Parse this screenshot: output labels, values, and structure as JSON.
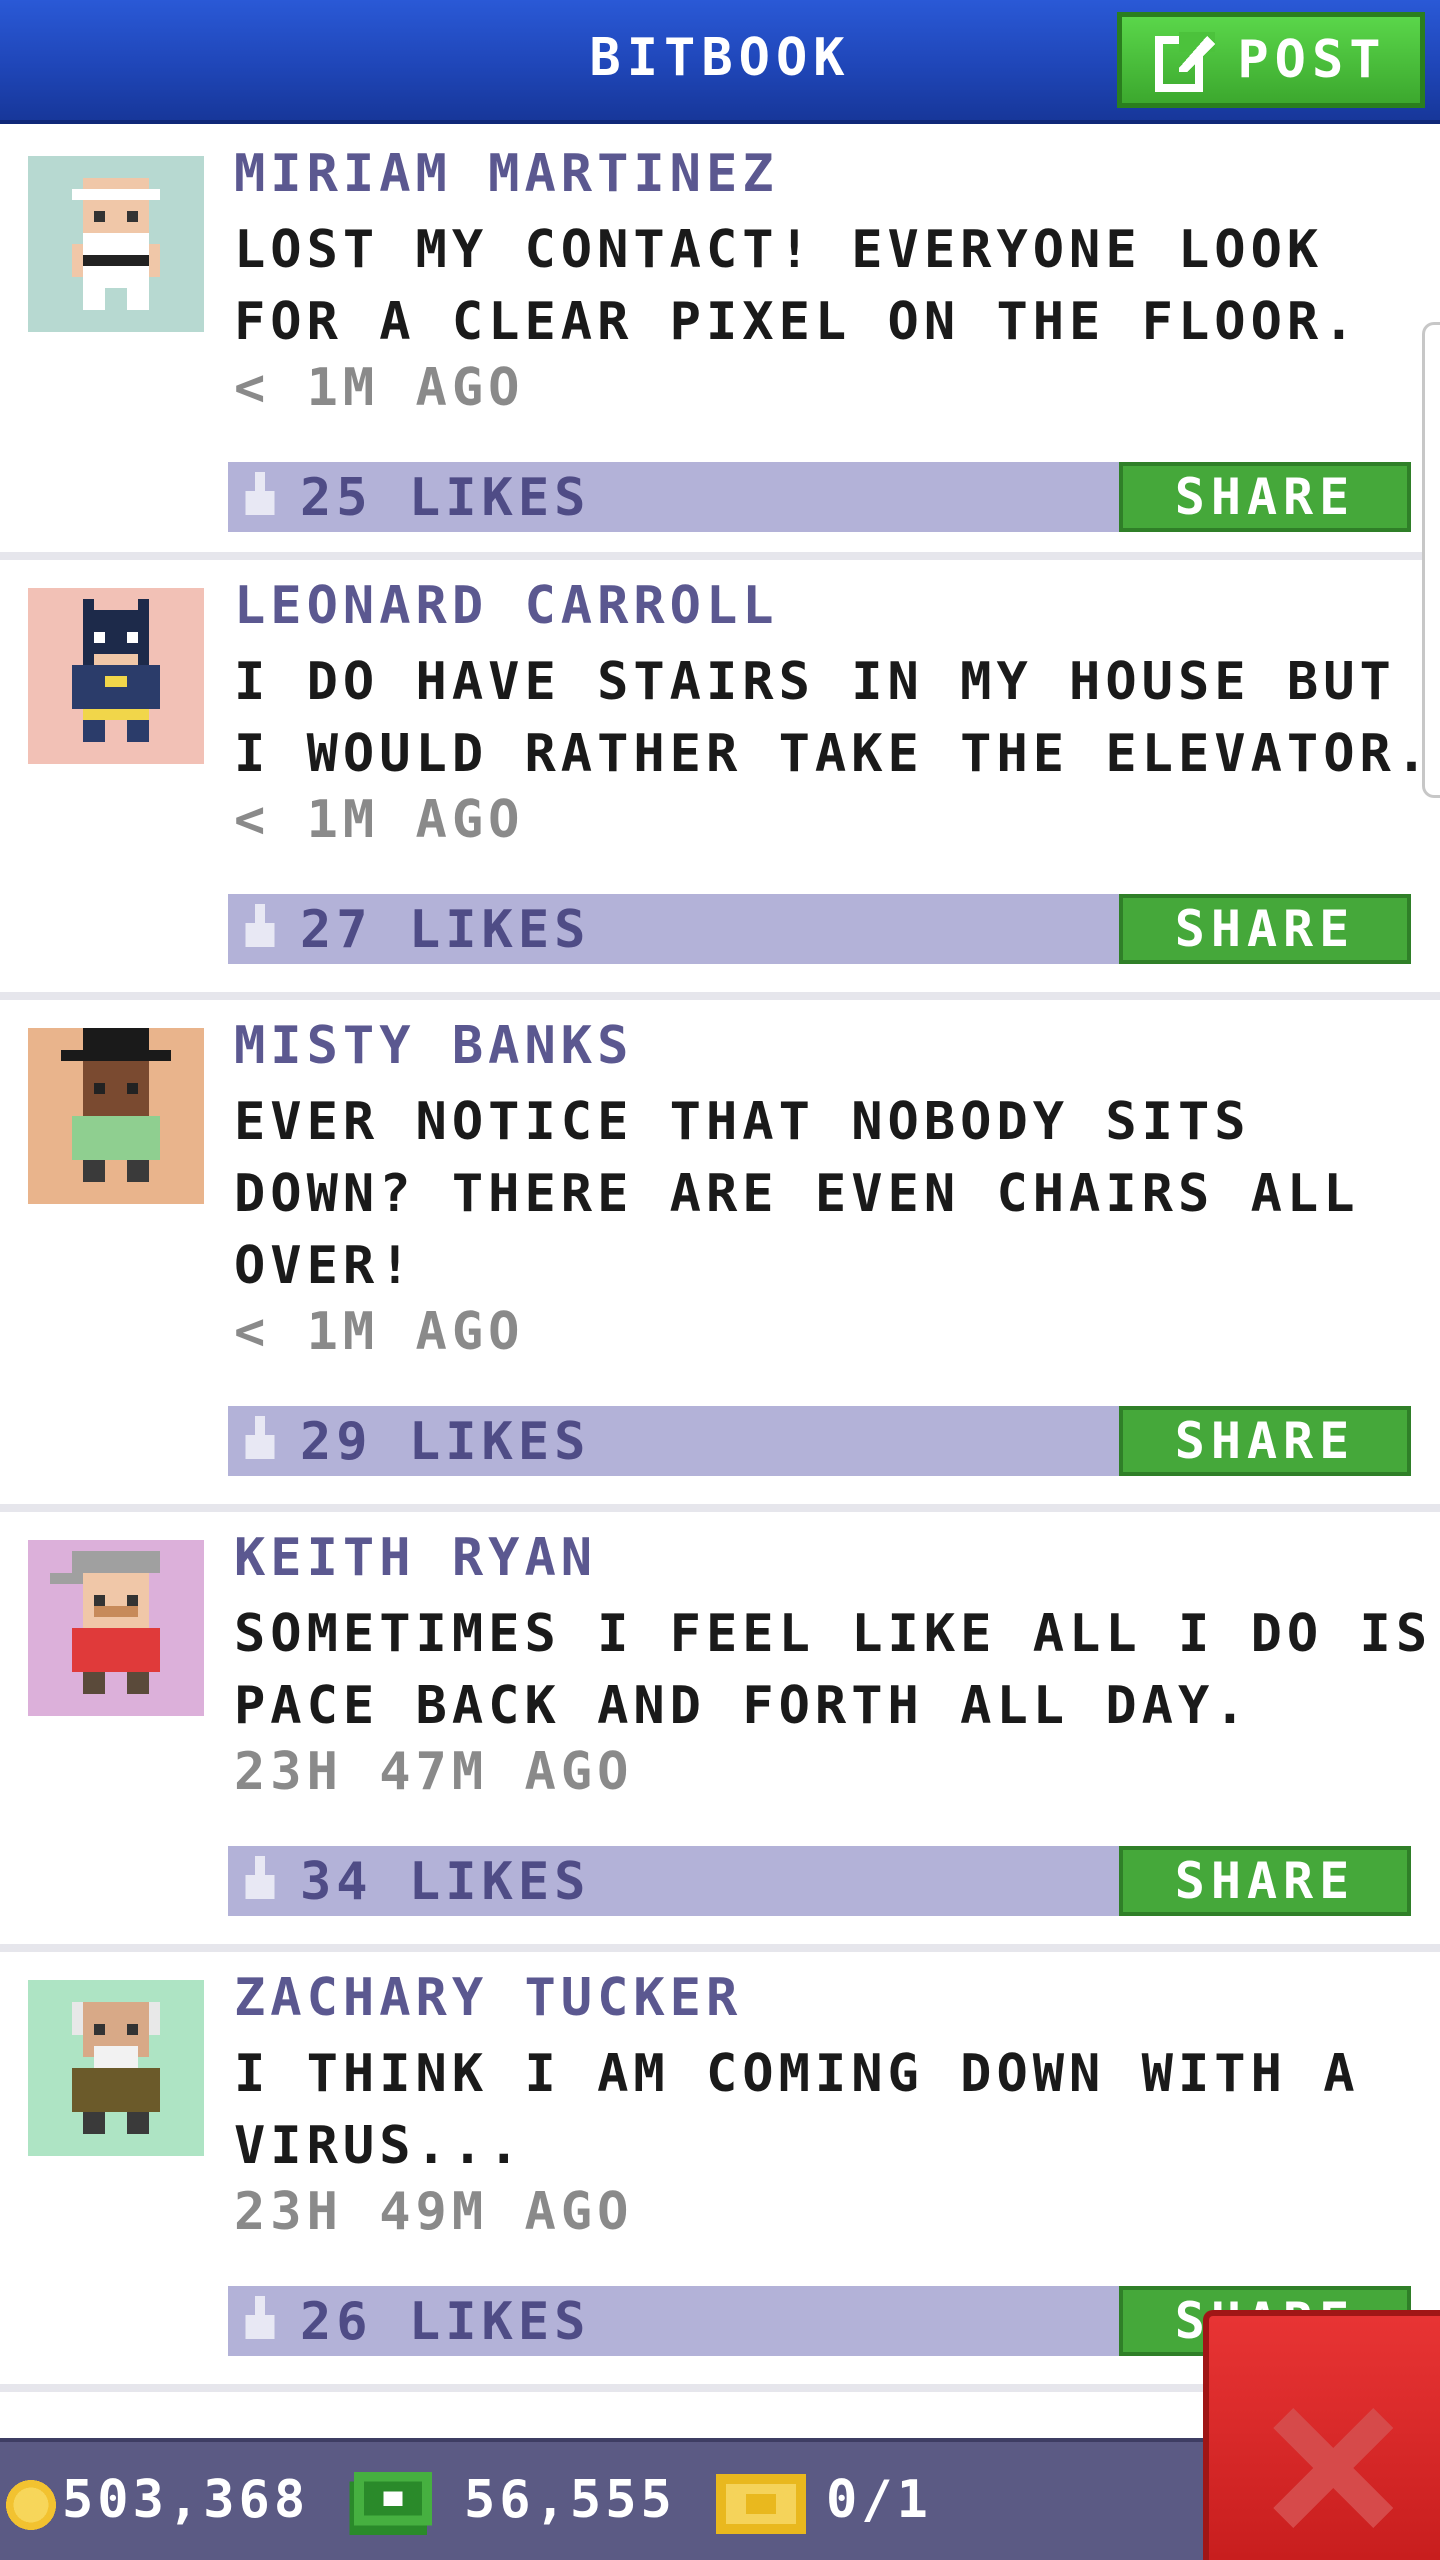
{
  "header": {
    "title": "BITBOOK",
    "post_label": "POST"
  },
  "colors": {
    "header_blue": "#1f46b8",
    "accent_green": "#45a83a",
    "like_bar": "#b3b2d8",
    "author_purple": "#5b5890",
    "close_red": "#d42626"
  },
  "posts": [
    {
      "author": "MIRIAM MARTINEZ",
      "message": "LOST MY CONTACT! EVERYONE LOOK FOR A CLEAR PIXEL ON THE FLOOR.",
      "time": "< 1M AGO",
      "likes": "25 LIKES",
      "share": "SHARE",
      "avatar_bg": "#b7d9d1",
      "avatar_icon": "karate-character-icon"
    },
    {
      "author": "LEONARD CARROLL",
      "message": "I DO HAVE STAIRS IN MY HOUSE BUT I WOULD RATHER TAKE THE ELEVATOR.",
      "time": "< 1M AGO",
      "likes": "27 LIKES",
      "share": "SHARE",
      "avatar_bg": "#f2c1b6",
      "avatar_icon": "bat-hero-character-icon"
    },
    {
      "author": "MISTY BANKS",
      "message": "EVER NOTICE THAT NOBODY SITS DOWN? THERE ARE EVEN CHAIRS ALL OVER!",
      "time": "< 1M AGO",
      "likes": "29 LIKES",
      "share": "SHARE",
      "avatar_bg": "#e9b48c",
      "avatar_icon": "top-hat-character-icon"
    },
    {
      "author": "KEITH RYAN",
      "message": "SOMETIMES I FEEL LIKE ALL I DO IS PACE BACK AND FORTH ALL DAY.",
      "time": "23H 47M AGO",
      "likes": "34 LIKES",
      "share": "SHARE",
      "avatar_bg": "#dcb0da",
      "avatar_icon": "cap-character-icon"
    },
    {
      "author": "ZACHARY TUCKER",
      "message": "I THINK I AM COMING DOWN WITH A VIRUS...",
      "time": "23H 49M AGO",
      "likes": "26 LIKES",
      "share": "SHARE",
      "avatar_bg": "#aee4c4",
      "avatar_icon": "old-man-character-icon"
    }
  ],
  "bottom_bar": {
    "coins": "503,368",
    "bux": "56,555",
    "tickets": "0/1"
  }
}
